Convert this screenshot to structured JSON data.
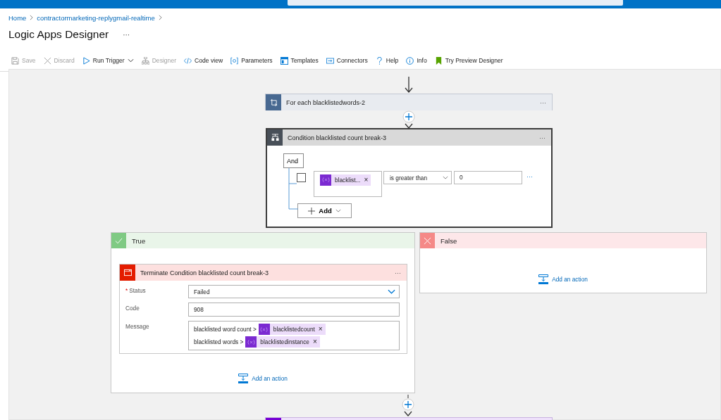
{
  "breadcrumb": [
    {
      "label": "Home"
    },
    {
      "label": "contractormarketing-replygmail-realtime"
    }
  ],
  "title": "Logic Apps Designer",
  "title_menu": "···",
  "toolbar": [
    {
      "label": "Save",
      "kind": "save",
      "disabled": true,
      "dropdown": false
    },
    {
      "label": "Discard",
      "kind": "discard",
      "disabled": true,
      "dropdown": false
    },
    {
      "label": "Run Trigger",
      "kind": "run",
      "disabled": false,
      "dropdown": true
    },
    {
      "label": "Designer",
      "kind": "designer",
      "disabled": true,
      "dropdown": false
    },
    {
      "label": "Code view",
      "kind": "code",
      "disabled": false,
      "dropdown": false
    },
    {
      "label": "Parameters",
      "kind": "parameters",
      "disabled": false,
      "dropdown": false
    },
    {
      "label": "Templates",
      "kind": "templates",
      "disabled": false,
      "dropdown": false
    },
    {
      "label": "Connectors",
      "kind": "connectors",
      "disabled": false,
      "dropdown": false
    },
    {
      "label": "Help",
      "kind": "help",
      "disabled": false,
      "dropdown": false
    },
    {
      "label": "Info",
      "kind": "info",
      "disabled": false,
      "dropdown": false
    },
    {
      "label": "Try Preview Designer",
      "kind": "preview",
      "disabled": false,
      "dropdown": false
    }
  ],
  "for_each": {
    "title": "For each blacklistedwords-2",
    "menu": "···"
  },
  "condition": {
    "title": "Condition blacklisted count break-3",
    "menu": "···",
    "group_operator": "And",
    "rows": [
      {
        "checked": false,
        "token": "blacklist...",
        "token_remove": "×",
        "operator": "is greater than",
        "value": "0",
        "menu": "···"
      }
    ],
    "add": "Add"
  },
  "true_branch": {
    "label": "True",
    "action": {
      "title": "Terminate Condition blacklisted count break-3",
      "menu": "···",
      "fields": [
        {
          "label": "Status",
          "required_mark": "*",
          "kind": "select",
          "value": "Failed"
        },
        {
          "label": "Code",
          "kind": "text",
          "value": "908"
        },
        {
          "label": "Message",
          "kind": "rich",
          "lines": [
            {
              "text": "blacklisted word count >",
              "token": "blacklistedcount",
              "remove": "×"
            },
            {
              "text": "blacklisted words >",
              "token": "blacklistedinstance",
              "remove": "×"
            }
          ]
        }
      ]
    },
    "add_action": "Add an action"
  },
  "false_branch": {
    "label": "False",
    "add_action": "Add an action"
  }
}
